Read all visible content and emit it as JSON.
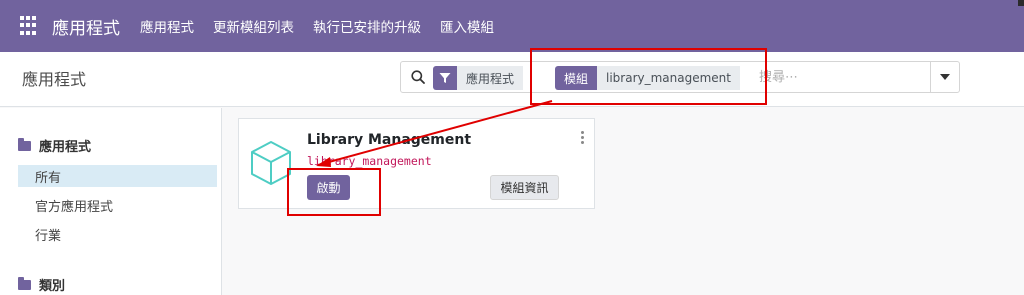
{
  "navbar": {
    "brand": "應用程式",
    "menu": [
      "應用程式",
      "更新模組列表",
      "執行已安排的升級",
      "匯入模組"
    ]
  },
  "control_panel": {
    "title": "應用程式",
    "facets": [
      {
        "tag": "",
        "value": "應用程式"
      },
      {
        "tag": "模組",
        "value": "library_management"
      }
    ],
    "search_placeholder": "搜尋⋯"
  },
  "sidebar": {
    "section1_title": "應用程式",
    "items": [
      "所有",
      "官方應用程式",
      "行業"
    ],
    "active_item": "所有",
    "section2_title": "類別"
  },
  "card": {
    "title": "Library Management",
    "technical_name": "library_management",
    "activate_label": "啟動",
    "info_label": "模組資訊"
  },
  "colors": {
    "brand": "#71639e",
    "annotation": "#e00000",
    "technical_name": "#c2185b",
    "module_icon": "#4ecdc4"
  }
}
